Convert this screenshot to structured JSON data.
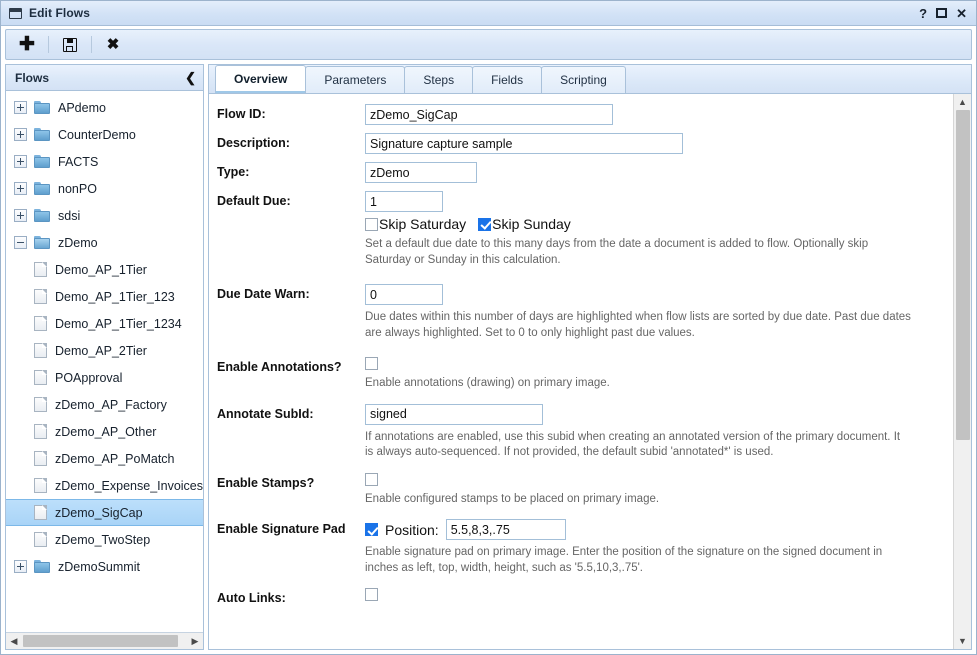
{
  "window": {
    "title": "Edit Flows",
    "icon": "window-icon",
    "controls": {
      "help": "?",
      "maximize": "",
      "close": "✕"
    }
  },
  "toolbar": {
    "buttons": [
      {
        "name": "add-flow-button",
        "icon": "plus-icon",
        "glyph": "✚"
      },
      {
        "name": "save-flow-button",
        "icon": "save-icon",
        "glyph": ""
      },
      {
        "name": "delete-flow-button",
        "icon": "close-x-icon",
        "glyph": "✖"
      }
    ]
  },
  "sidebar": {
    "title": "Flows",
    "collapse_glyph": "❮",
    "tree": [
      {
        "label": "APdemo",
        "type": "folder",
        "state": "collapsed",
        "depth": 0,
        "selected": false
      },
      {
        "label": "CounterDemo",
        "type": "folder",
        "state": "collapsed",
        "depth": 0,
        "selected": false
      },
      {
        "label": "FACTS",
        "type": "folder",
        "state": "collapsed",
        "depth": 0,
        "selected": false
      },
      {
        "label": "nonPO",
        "type": "folder",
        "state": "collapsed",
        "depth": 0,
        "selected": false
      },
      {
        "label": "sdsi",
        "type": "folder",
        "state": "collapsed",
        "depth": 0,
        "selected": false
      },
      {
        "label": "zDemo",
        "type": "folder",
        "state": "expanded",
        "depth": 0,
        "selected": false
      },
      {
        "label": "Demo_AP_1Tier",
        "type": "file",
        "state": "leaf",
        "depth": 1,
        "selected": false
      },
      {
        "label": "Demo_AP_1Tier_123",
        "type": "file",
        "state": "leaf",
        "depth": 1,
        "selected": false
      },
      {
        "label": "Demo_AP_1Tier_1234",
        "type": "file",
        "state": "leaf",
        "depth": 1,
        "selected": false
      },
      {
        "label": "Demo_AP_2Tier",
        "type": "file",
        "state": "leaf",
        "depth": 1,
        "selected": false
      },
      {
        "label": "POApproval",
        "type": "file",
        "state": "leaf",
        "depth": 1,
        "selected": false
      },
      {
        "label": "zDemo_AP_Factory",
        "type": "file",
        "state": "leaf",
        "depth": 1,
        "selected": false
      },
      {
        "label": "zDemo_AP_Other",
        "type": "file",
        "state": "leaf",
        "depth": 1,
        "selected": false
      },
      {
        "label": "zDemo_AP_PoMatch",
        "type": "file",
        "state": "leaf",
        "depth": 1,
        "selected": false
      },
      {
        "label": "zDemo_Expense_Invoices",
        "type": "file",
        "state": "leaf",
        "depth": 1,
        "selected": false
      },
      {
        "label": "zDemo_SigCap",
        "type": "file",
        "state": "leaf",
        "depth": 1,
        "selected": true
      },
      {
        "label": "zDemo_TwoStep",
        "type": "file",
        "state": "leaf",
        "depth": 1,
        "selected": false
      },
      {
        "label": "zDemoSummit",
        "type": "folder",
        "state": "collapsed",
        "depth": 0,
        "selected": false
      }
    ],
    "hscroll": {
      "left_glyph": "◀",
      "right_glyph": "▶"
    }
  },
  "tabs": [
    {
      "label": "Overview",
      "active": true
    },
    {
      "label": "Parameters",
      "active": false
    },
    {
      "label": "Steps",
      "active": false
    },
    {
      "label": "Fields",
      "active": false
    },
    {
      "label": "Scripting",
      "active": false
    }
  ],
  "form": {
    "flow_id": {
      "label": "Flow ID:",
      "value": "zDemo_SigCap"
    },
    "description": {
      "label": "Description:",
      "value": "Signature capture sample"
    },
    "type": {
      "label": "Type:",
      "value": "zDemo"
    },
    "default_due": {
      "label": "Default Due:",
      "value": "1",
      "skip_saturday": {
        "label": "Skip Saturday",
        "checked": false
      },
      "skip_sunday": {
        "label": "Skip Sunday",
        "checked": true
      },
      "help": "Set a default due date to this many days from the date a document is added to flow. Optionally skip Saturday or Sunday in this calculation."
    },
    "due_date_warn": {
      "label": "Due Date Warn:",
      "value": "0",
      "help": "Due dates within this number of days are highlighted when flow lists are sorted by due date. Past due dates are always highlighted. Set to 0 to only highlight past due values."
    },
    "enable_annotations": {
      "label": "Enable Annotations?",
      "checked": false,
      "help": "Enable annotations (drawing) on primary image."
    },
    "annotate_subid": {
      "label": "Annotate SubId:",
      "value": "signed",
      "help": "If annotations are enabled, use this subid when creating an annotated version of the primary document. It is always auto-sequenced. If not provided, the default subid 'annotated*' is used."
    },
    "enable_stamps": {
      "label": "Enable Stamps?",
      "checked": false,
      "help": "Enable configured stamps to be placed on primary image."
    },
    "enable_signature_pad": {
      "label": "Enable Signature Pad",
      "checked": true,
      "position_label": "Position:",
      "position_value": "5.5,8,3,.75",
      "help": "Enable signature pad on primary image. Enter the position of the signature on the signed document in inches as left, top, width, height, such as '5.5,10,3,.75'."
    },
    "auto_links": {
      "label": "Auto Links:",
      "checked": false
    }
  },
  "vscroll": {
    "up_glyph": "▲",
    "down_glyph": "▼"
  },
  "colors": {
    "accent": "#1a73e8",
    "chrome": "#d4e2f5",
    "border": "#a9c1da",
    "selection": "#a9d4f7"
  }
}
